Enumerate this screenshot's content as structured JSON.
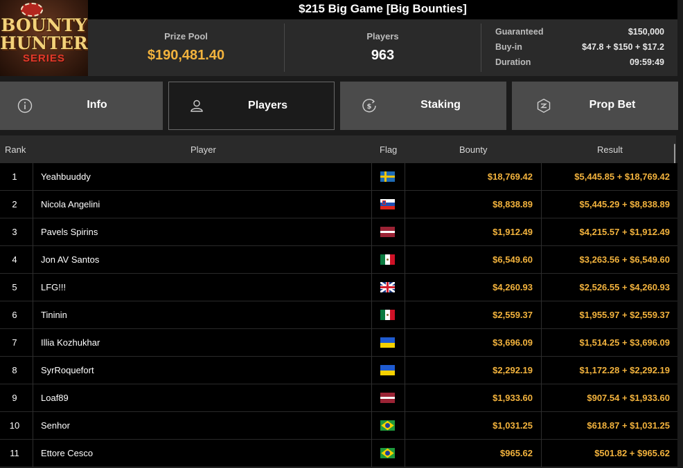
{
  "header": {
    "logo": {
      "line1": "BOUNTY",
      "line2": "HUNTERS",
      "line3": "SERIES"
    },
    "title": "$215 Big Game [Big Bounties]",
    "prize_pool_label": "Prize Pool",
    "prize_pool_value": "$190,481.40",
    "players_label": "Players",
    "players_value": "963",
    "details": [
      {
        "key": "Guaranteed",
        "value": "$150,000"
      },
      {
        "key": "Buy-in",
        "value": "$47.8 + $150 + $17.2"
      },
      {
        "key": "Duration",
        "value": "09:59:49"
      }
    ]
  },
  "tabs": [
    {
      "label": "Info",
      "icon": "info-icon",
      "active": false
    },
    {
      "label": "Players",
      "icon": "user-icon",
      "active": true
    },
    {
      "label": "Staking",
      "icon": "dollar-circle-icon",
      "active": false
    },
    {
      "label": "Prop Bet",
      "icon": "prop-bet-icon",
      "active": false
    }
  ],
  "table": {
    "columns": {
      "rank": "Rank",
      "player": "Player",
      "flag": "Flag",
      "bounty": "Bounty",
      "result": "Result"
    },
    "rows": [
      {
        "rank": "1",
        "player": "Yeahbuuddy",
        "flag": "sweden",
        "bounty": "$18,769.42",
        "result": "$5,445.85 + $18,769.42"
      },
      {
        "rank": "2",
        "player": "Nicola Angelini",
        "flag": "slovenia",
        "bounty": "$8,838.89",
        "result": "$5,445.29 + $8,838.89"
      },
      {
        "rank": "3",
        "player": "Pavels Spirins",
        "flag": "latvia",
        "bounty": "$1,912.49",
        "result": "$4,215.57 + $1,912.49"
      },
      {
        "rank": "4",
        "player": "Jon AV Santos",
        "flag": "mexico",
        "bounty": "$6,549.60",
        "result": "$3,263.56 + $6,549.60"
      },
      {
        "rank": "5",
        "player": "LFG!!!",
        "flag": "united-kingdom",
        "bounty": "$4,260.93",
        "result": "$2,526.55 + $4,260.93"
      },
      {
        "rank": "6",
        "player": "Tininin",
        "flag": "mexico",
        "bounty": "$2,559.37",
        "result": "$1,955.97 + $2,559.37"
      },
      {
        "rank": "7",
        "player": "Illia Kozhukhar",
        "flag": "ukraine",
        "bounty": "$3,696.09",
        "result": "$1,514.25 + $3,696.09"
      },
      {
        "rank": "8",
        "player": "SyrRoquefort",
        "flag": "ukraine",
        "bounty": "$2,292.19",
        "result": "$1,172.28 + $2,292.19"
      },
      {
        "rank": "9",
        "player": "Loaf89",
        "flag": "latvia",
        "bounty": "$1,933.60",
        "result": "$907.54 + $1,933.60"
      },
      {
        "rank": "10",
        "player": "Senhor",
        "flag": "brazil",
        "bounty": "$1,031.25",
        "result": "$618.87 + $1,031.25"
      },
      {
        "rank": "11",
        "player": "Ettore Cesco",
        "flag": "brazil",
        "bounty": "$965.62",
        "result": "$501.82 + $965.62"
      }
    ]
  },
  "colors": {
    "accent_gold": "#f3b33d",
    "tab_bg": "#4b4b4b",
    "row_bg": "#000000"
  }
}
